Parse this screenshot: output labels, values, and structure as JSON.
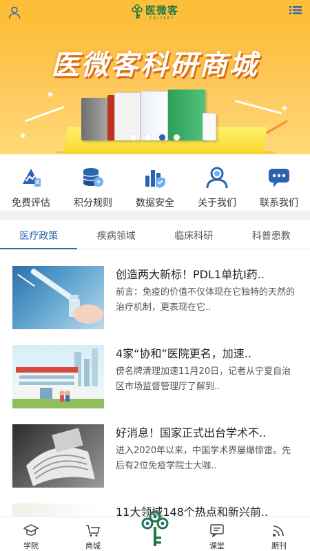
{
  "header": {
    "logo_text": "医微客",
    "logo_sub": "EWITKEY",
    "icons": [
      "user-icon",
      "list-menu-icon"
    ]
  },
  "banner": {
    "title": "医微客科研商城",
    "slide_count": 4,
    "active_slide": 3
  },
  "quick_nav": [
    {
      "label": "免费评估",
      "icon": "assessment-icon"
    },
    {
      "label": "积分规则",
      "icon": "points-icon"
    },
    {
      "label": "数据安全",
      "icon": "data-security-icon"
    },
    {
      "label": "关于我们",
      "icon": "about-us-icon"
    },
    {
      "label": "联系我们",
      "icon": "contact-icon"
    }
  ],
  "tabs": [
    {
      "label": "医疗政策",
      "active": true
    },
    {
      "label": "疾病领域",
      "active": false
    },
    {
      "label": "临床科研",
      "active": false
    },
    {
      "label": "科普患教",
      "active": false
    }
  ],
  "articles": [
    {
      "title": "创造两大新标！PDL1单抗I药..",
      "desc": "前言：免疫的价值不仅体现在它独特的天然的治疗机制，更表现在它..",
      "thumb": "syringe-vial"
    },
    {
      "title": "4家“协和”医院更名，加速..",
      "desc": "傍名牌清理加速11月20日，记者从宁夏自治区市场监督管理厅了解到..",
      "thumb": "hospital"
    },
    {
      "title": "好消息！国家正式出台学术不..",
      "desc": "进入2020年以来，中国学术界屡爆惊雷。先后有2位免疫学院士大咖..",
      "thumb": "newspaper"
    },
    {
      "title": "11大领域148个热点和新兴前..",
      "desc": "",
      "thumb": "research"
    }
  ],
  "bottom_nav": [
    {
      "label": "学院",
      "icon": "academy-icon"
    },
    {
      "label": "商城",
      "icon": "cart-icon"
    },
    {
      "label": "",
      "icon": "center-logo-icon"
    },
    {
      "label": "课堂",
      "icon": "classroom-icon"
    },
    {
      "label": "期刊",
      "icon": "journal-icon"
    }
  ],
  "colors": {
    "accent": "#2c63b0",
    "header_bg": "#fdbe3a",
    "logo_green": "#1d7a45"
  }
}
